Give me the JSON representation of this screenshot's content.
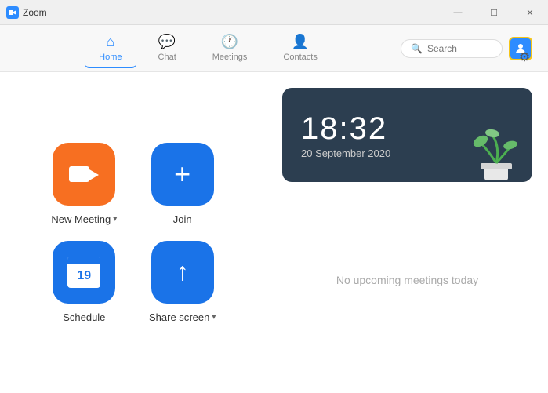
{
  "titlebar": {
    "title": "Zoom",
    "minimize_label": "—",
    "restore_label": "☐",
    "close_label": "✕"
  },
  "navbar": {
    "items": [
      {
        "id": "home",
        "label": "Home",
        "active": true
      },
      {
        "id": "chat",
        "label": "Chat",
        "active": false
      },
      {
        "id": "meetings",
        "label": "Meetings",
        "active": false
      },
      {
        "id": "contacts",
        "label": "Contacts",
        "active": false
      }
    ],
    "search_placeholder": "Search"
  },
  "actions": [
    {
      "id": "new-meeting",
      "label": "New Meeting",
      "has_caret": true,
      "color": "orange"
    },
    {
      "id": "join",
      "label": "Join",
      "has_caret": false,
      "color": "blue"
    },
    {
      "id": "schedule",
      "label": "Schedule",
      "has_caret": false,
      "color": "blue"
    },
    {
      "id": "share-screen",
      "label": "Share screen",
      "has_caret": true,
      "color": "blue"
    }
  ],
  "clock": {
    "time": "18:32",
    "date": "20 September 2020"
  },
  "meetings": {
    "empty_label": "No upcoming meetings today"
  },
  "calendar_day": "19"
}
